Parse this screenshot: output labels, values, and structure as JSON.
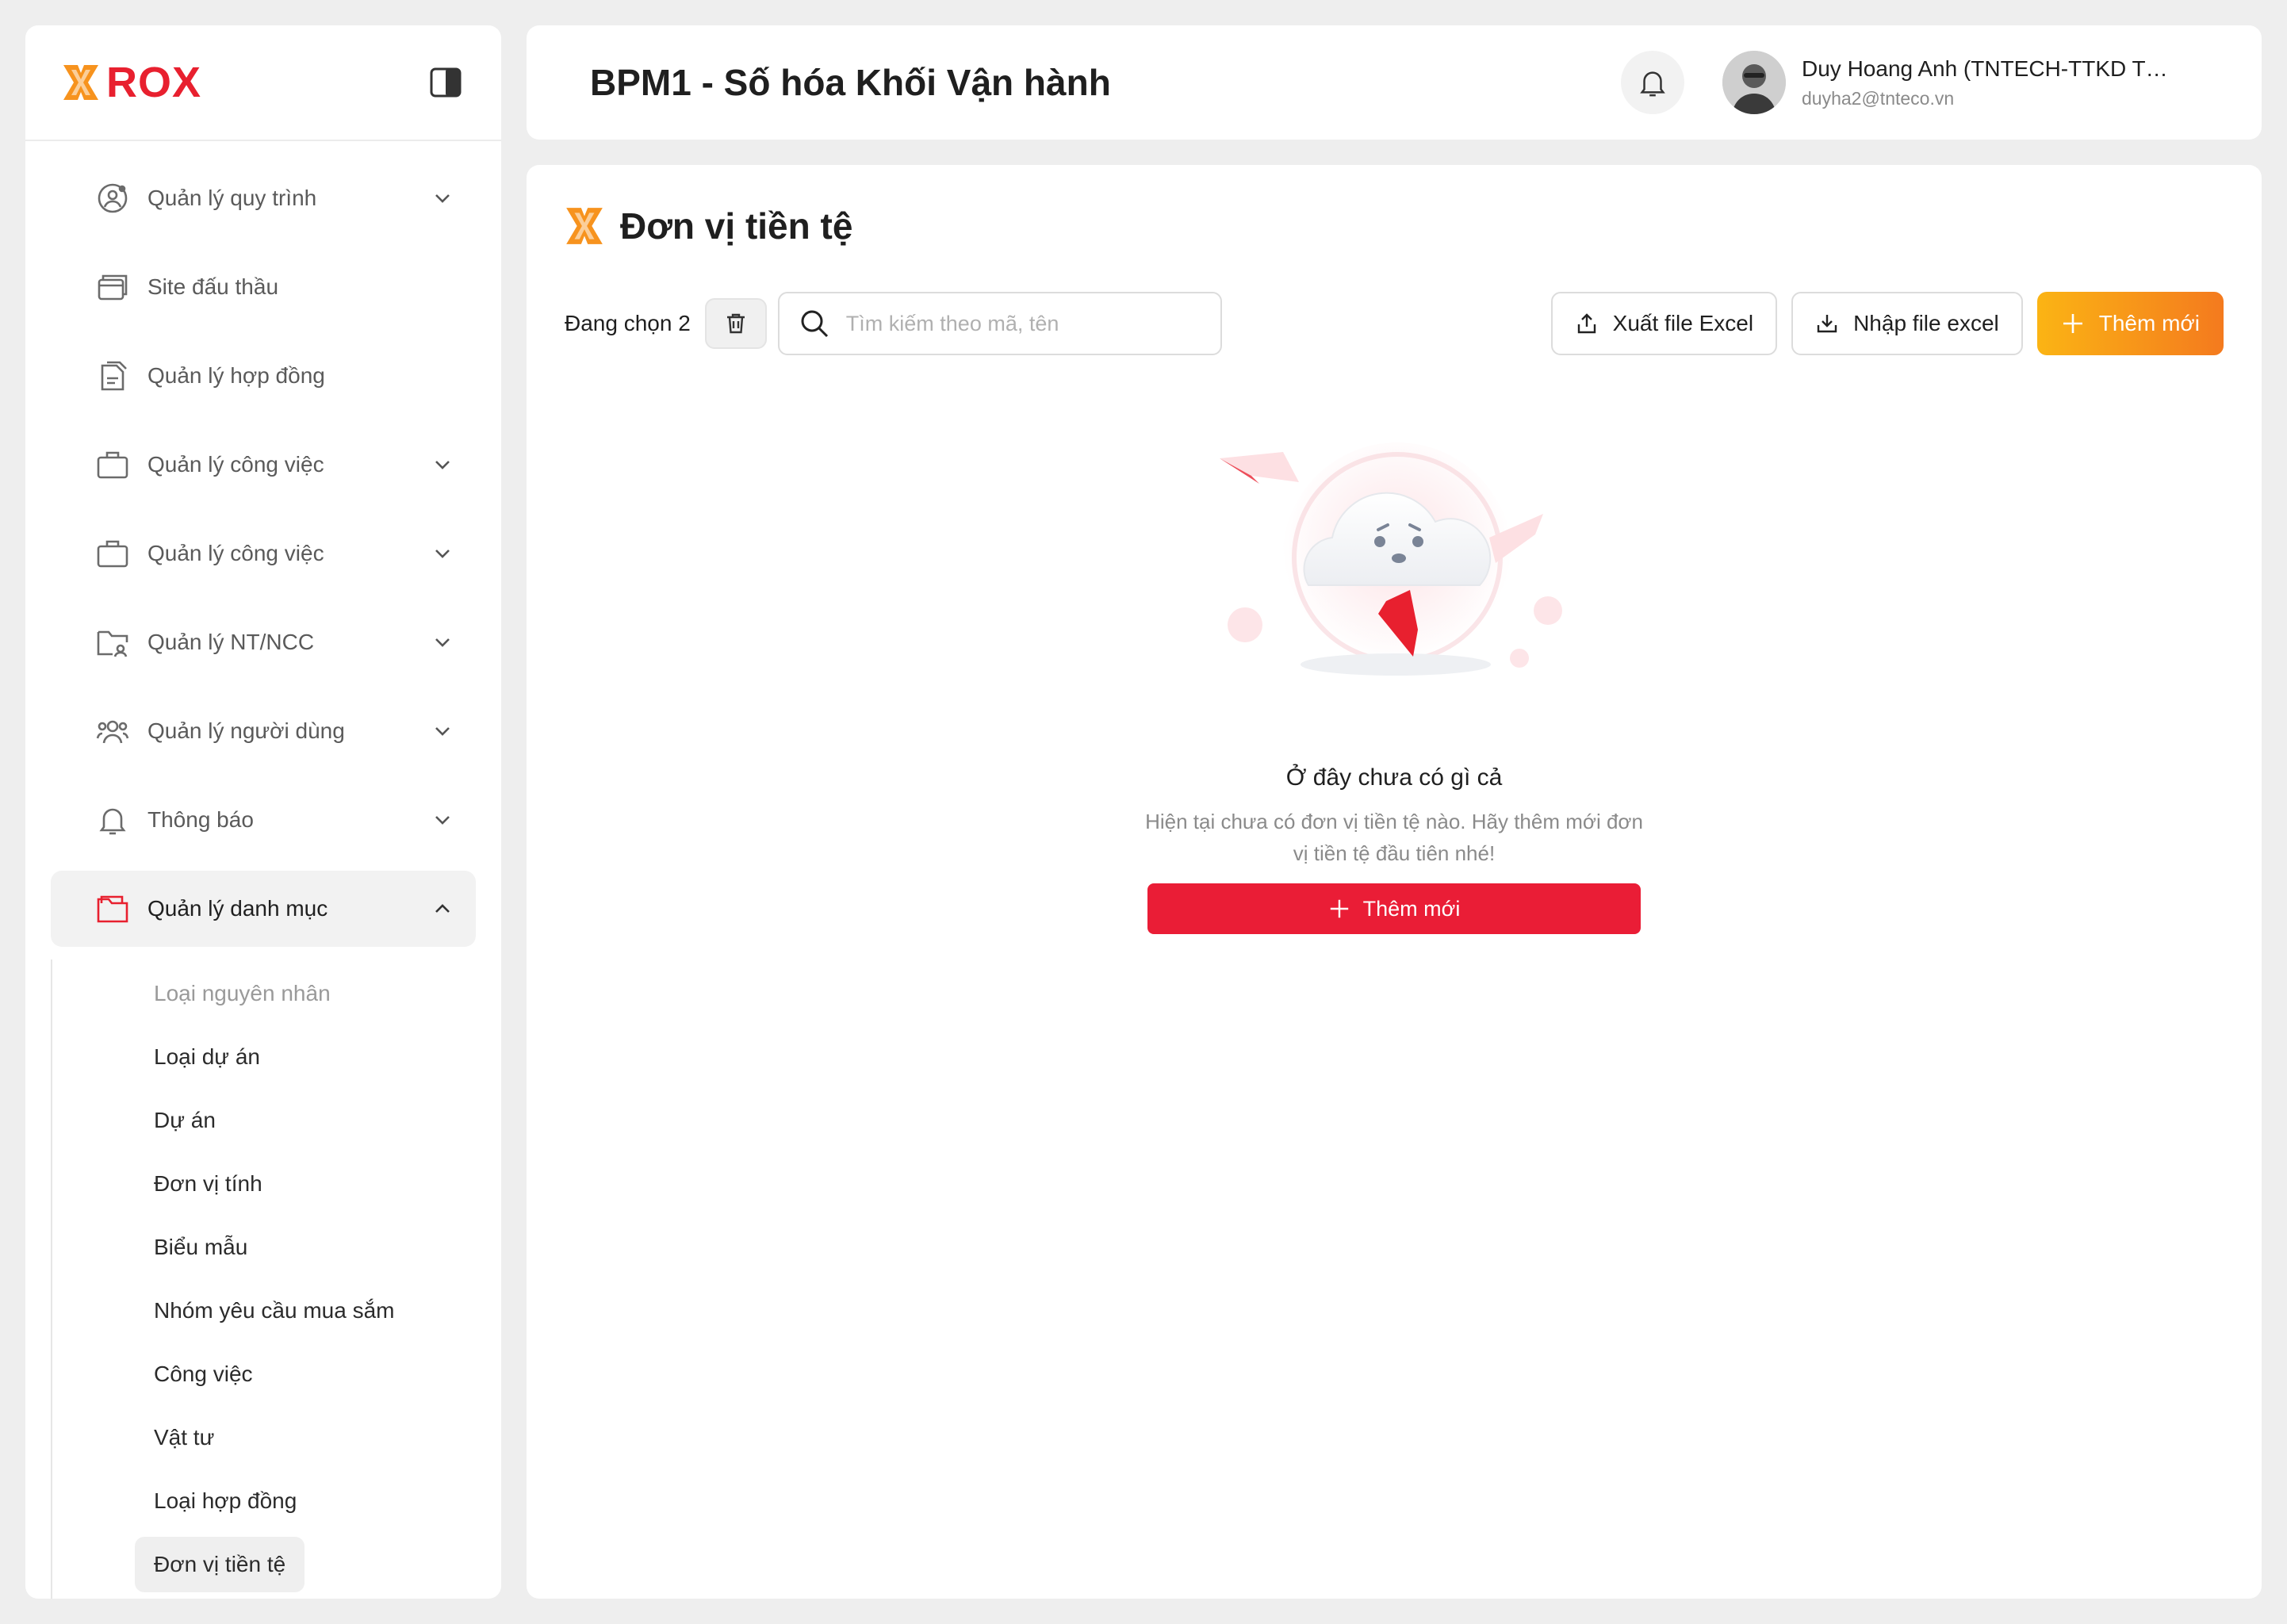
{
  "brand": {
    "logo_text": "ROX",
    "accent": "#e8202f",
    "orange": "#f7931e"
  },
  "sidebar": {
    "items": [
      {
        "label": "Quản lý quy trình",
        "icon": "user-settings-icon",
        "chevron": "down"
      },
      {
        "label": "Site đấu thầu",
        "icon": "window-stack-icon",
        "chevron": ""
      },
      {
        "label": "Quản lý hợp đồng",
        "icon": "documents-icon",
        "chevron": ""
      },
      {
        "label": "Quản lý công việc",
        "icon": "briefcase-icon",
        "chevron": "down"
      },
      {
        "label": "Quản lý công việc",
        "icon": "briefcase-icon",
        "chevron": "down"
      },
      {
        "label": "Quản lý NT/NCC",
        "icon": "folder-user-icon",
        "chevron": "down"
      },
      {
        "label": "Quản lý người dùng",
        "icon": "users-icon",
        "chevron": "down"
      },
      {
        "label": "Thông báo",
        "icon": "bell-icon",
        "chevron": "down"
      },
      {
        "label": "Quản lý danh mục",
        "icon": "folder-icon",
        "chevron": "up",
        "active": true
      }
    ],
    "subitems": [
      {
        "label": "Loại nguyên nhân",
        "state": "muted"
      },
      {
        "label": "Loại dự án",
        "state": ""
      },
      {
        "label": "Dự án",
        "state": ""
      },
      {
        "label": "Đơn vị tính",
        "state": ""
      },
      {
        "label": "Biểu mẫu",
        "state": ""
      },
      {
        "label": "Nhóm yêu cầu mua sắm",
        "state": ""
      },
      {
        "label": "Công việc",
        "state": ""
      },
      {
        "label": "Vật tư",
        "state": ""
      },
      {
        "label": "Loại hợp đồng",
        "state": ""
      },
      {
        "label": "Đơn vị tiền tệ",
        "state": "active"
      }
    ]
  },
  "header": {
    "title": "BPM1 - Số hóa Khối Vận hành",
    "user_name": "Duy Hoang Anh (TNTECH-TTKD TKTC)",
    "user_email": "duyha2@tnteco.vn"
  },
  "main": {
    "page_title": "Đơn vị tiền tệ",
    "selected_label": "Đang chọn 2",
    "search_placeholder": "Tìm kiếm theo mã, tên",
    "search_value": "",
    "export_label": "Xuất file Excel",
    "import_label": "Nhập file excel",
    "add_label": "Thêm mới"
  },
  "empty_state": {
    "title": "Ở đây chưa có gì cả",
    "description": "Hiện tại chưa có đơn vị tiền tệ nào. Hãy thêm mới đơn vị tiền tệ đầu tiên nhé!",
    "button_label": "Thêm mới"
  }
}
